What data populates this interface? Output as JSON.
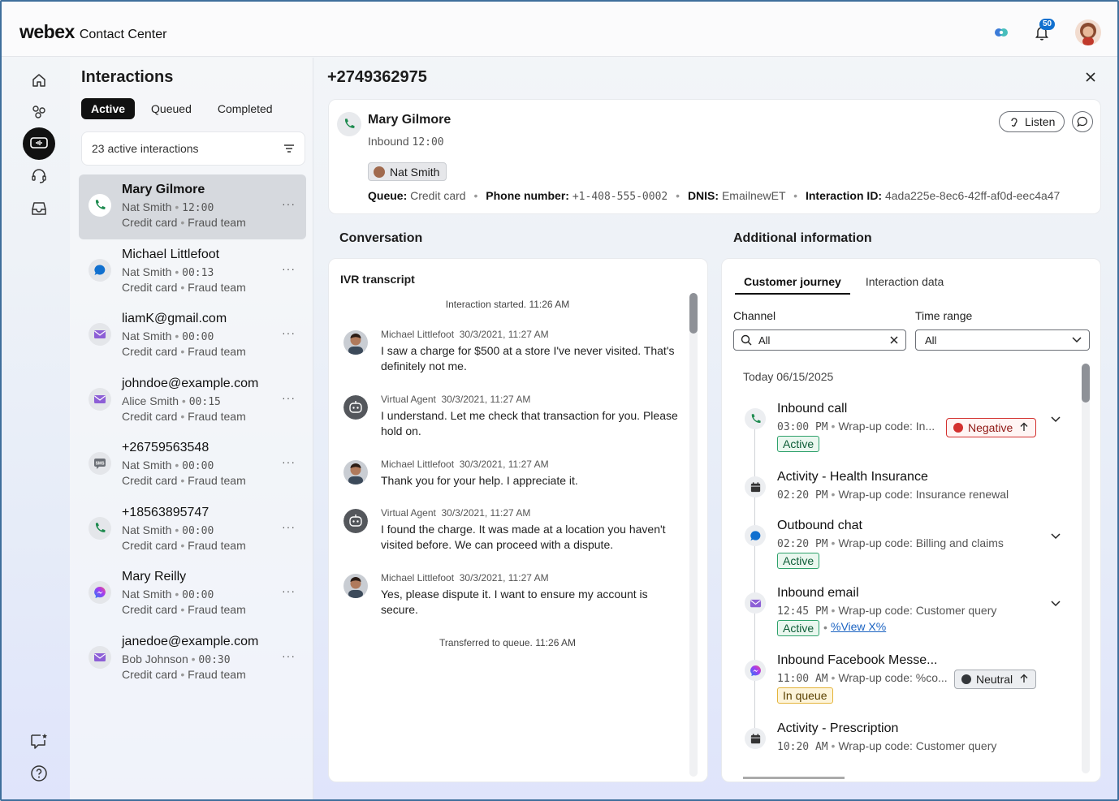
{
  "app": {
    "brand_main": "webex",
    "brand_sub": "Contact Center",
    "notification_count": "50"
  },
  "interactions": {
    "title": "Interactions",
    "tabs": [
      "Active",
      "Queued",
      "Completed"
    ],
    "search_text": "23 active interactions",
    "items": [
      {
        "name": "Mary Gilmore",
        "agent": "Nat Smith",
        "time": "12:00",
        "queue": "Credit card",
        "team": "Fraud team",
        "channel": "phone",
        "selected": true
      },
      {
        "name": "Michael Littlefoot",
        "agent": "Nat Smith",
        "time": "00:13",
        "queue": "Credit card",
        "team": "Fraud team",
        "channel": "chat",
        "selected": false
      },
      {
        "name": "liamK@gmail.com",
        "agent": "Nat Smith",
        "time": "00:00",
        "queue": "Credit card",
        "team": "Fraud team",
        "channel": "email",
        "selected": false
      },
      {
        "name": "johndoe@example.com",
        "agent": "Alice Smith",
        "time": "00:15",
        "queue": "Credit card",
        "team": "Fraud team",
        "channel": "email",
        "selected": false
      },
      {
        "name": "+26759563548",
        "agent": "Nat Smith",
        "time": "00:00",
        "queue": "Credit card",
        "team": "Fraud team",
        "channel": "sms",
        "selected": false
      },
      {
        "name": "+18563895747",
        "agent": "Nat Smith",
        "time": "00:00",
        "queue": "Credit card",
        "team": "Fraud team",
        "channel": "phone",
        "selected": false
      },
      {
        "name": "Mary Reilly",
        "agent": "Nat Smith",
        "time": "00:00",
        "queue": "Credit card",
        "team": "Fraud team",
        "channel": "messenger",
        "selected": false
      },
      {
        "name": "janedoe@example.com",
        "agent": "Bob Johnson",
        "time": "00:30",
        "queue": "Credit card",
        "team": "Fraud team",
        "channel": "email",
        "selected": false
      }
    ]
  },
  "detail": {
    "phone": "+2749362975",
    "customer_name": "Mary Gilmore",
    "direction": "Inbound",
    "time": "12:00",
    "agent": "Nat Smith",
    "listen_label": "Listen",
    "queue_label": "Queue:",
    "queue_value": "Credit card",
    "phone_label": "Phone number:",
    "phone_value": "+1-408-555-0002",
    "dnis_label": "DNIS:",
    "dnis_value": "EmailnewET",
    "id_label": "Interaction ID:",
    "id_value": "4ada225e-8ec6-42ff-af0d-eec4a47"
  },
  "conversation": {
    "title": "Conversation",
    "ivr_title": "IVR transcript",
    "start_msg": "Interaction started. 11:26 AM",
    "end_msg": "Transferred to queue. 11:26 AM",
    "messages": [
      {
        "sender": "Michael Littlefoot",
        "time": "30/3/2021, 11:27 AM",
        "text": "I saw a charge for $500 at a store I've never visited. That's definitely not me.",
        "kind": "customer"
      },
      {
        "sender": "Virtual Agent",
        "time": "30/3/2021, 11:27 AM",
        "text": "I understand. Let me check that transaction for you. Please hold on.",
        "kind": "bot"
      },
      {
        "sender": "Michael Littlefoot",
        "time": "30/3/2021, 11:27 AM",
        "text": "Thank you for your help. I appreciate it.",
        "kind": "customer"
      },
      {
        "sender": "Virtual Agent",
        "time": "30/3/2021, 11:27 AM",
        "text": "I found the charge. It was made at a location you haven't visited before. We can proceed with a dispute.",
        "kind": "bot"
      },
      {
        "sender": "Michael Littlefoot",
        "time": "30/3/2021, 11:27 AM",
        "text": "Yes, please dispute it. I want to ensure my account is secure.",
        "kind": "customer"
      }
    ]
  },
  "additional": {
    "title": "Additional information",
    "tabs": [
      "Customer journey",
      "Interaction data"
    ],
    "channel_label": "Channel",
    "channel_value": "All",
    "time_label": "Time range",
    "time_value": "All",
    "today_label": "Today 06/15/2025",
    "journey": [
      {
        "title": "Inbound call",
        "time": "03:00 PM",
        "detail": "Wrap-up code: In...",
        "status": "Active",
        "sentiment": "Negative",
        "icon": "phone",
        "expandable": true
      },
      {
        "title": "Activity - Health Insurance",
        "time": "02:20 PM",
        "detail": "Wrap-up code: Insurance renewal",
        "icon": "calendar",
        "expandable": false
      },
      {
        "title": "Outbound chat",
        "time": "02:20 PM",
        "detail": "Wrap-up code: Billing and claims",
        "status": "Active",
        "icon": "chat",
        "expandable": true
      },
      {
        "title": "Inbound email",
        "time": "12:45 PM",
        "detail": "Wrap-up code: Customer query",
        "status": "Active",
        "link": "%View X%",
        "icon": "email",
        "expandable": true
      },
      {
        "title": "Inbound Facebook Messe...",
        "time": "11:00 AM",
        "detail": "Wrap-up code: %co...",
        "status": "In queue",
        "sentiment": "Neutral",
        "icon": "messenger",
        "expandable": false
      },
      {
        "title": "Activity - Prescription",
        "time": "10:20 AM",
        "detail": "Wrap-up code: Customer query",
        "icon": "calendar",
        "expandable": false
      }
    ]
  },
  "colors": {
    "phone_green": "#1d8a4e",
    "chat_blue": "#1170cf",
    "email_purple": "#8d5fd6",
    "negative_red": "#d3312f"
  }
}
